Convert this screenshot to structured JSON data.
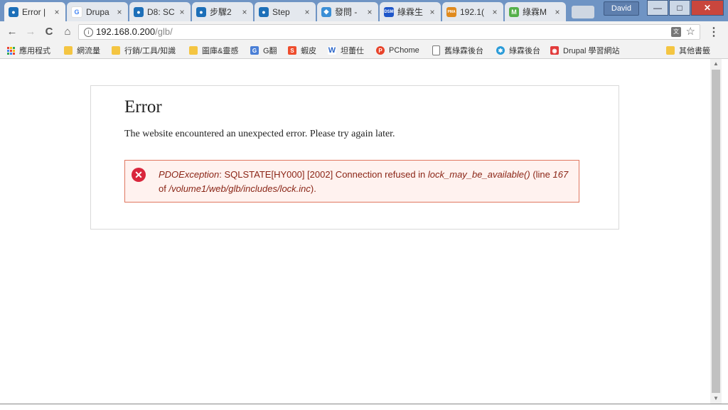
{
  "tabs": [
    {
      "title": "Error |",
      "color": "#1d6fb8",
      "icon": "drupal-icon",
      "active": true
    },
    {
      "title": "Drupa",
      "color": "#4285f4",
      "icon": "google-icon"
    },
    {
      "title": "D8: SC",
      "color": "#1d6fb8",
      "icon": "drupal-icon"
    },
    {
      "title": "步驟2",
      "color": "#1d6fb8",
      "icon": "drupal-icon"
    },
    {
      "title": "Step",
      "color": "#1d6fb8",
      "icon": "drupal-icon"
    },
    {
      "title": "發問 -",
      "color": "#3b8fd6",
      "icon": "forum-icon"
    },
    {
      "title": "綠霖生",
      "color": "#1f56c9",
      "icon": "dsm-icon",
      "icon_text": "DSM"
    },
    {
      "title": "192.1(",
      "color": "#e08a1e",
      "icon": "pma-icon",
      "icon_text": "PMA"
    },
    {
      "title": "綠霖M",
      "color": "#55b04a",
      "icon": "m-icon",
      "icon_text": "M"
    }
  ],
  "tab_close": "×",
  "window": {
    "user": "David",
    "minimize": "—",
    "maximize": "□",
    "close": "✕"
  },
  "toolbar": {
    "back": "←",
    "forward": "→",
    "reload": "C",
    "home": "⌂",
    "url_host": "192.168.0.200",
    "url_path": "/glb/",
    "info": "i",
    "translate": "文",
    "star": "☆",
    "menu": "⋮"
  },
  "bookmarks": [
    {
      "label": "應用程式",
      "icon": "apps-icon"
    },
    {
      "label": "網流量",
      "icon": "folder-icon"
    },
    {
      "label": "行銷/工具/知識",
      "icon": "folder-icon"
    },
    {
      "label": "圖庫&靈感",
      "icon": "folder-icon"
    },
    {
      "label": "G翻",
      "icon": "translate-icon",
      "color": "#4a7fd6"
    },
    {
      "label": "蝦皮",
      "icon": "shopee-icon",
      "color": "#ee4d2d",
      "icon_text": "S"
    },
    {
      "label": "坦蕾仕",
      "icon": "w-icon",
      "color": "#2b66c9",
      "icon_text": "W"
    },
    {
      "label": "PChome",
      "icon": "pchome-icon",
      "color": "#e8432a",
      "icon_text": "P"
    },
    {
      "label": "舊綠霖後台",
      "icon": "page-icon"
    },
    {
      "label": "綠霖後台",
      "icon": "gear-icon",
      "color": "#2a9bd8"
    },
    {
      "label": "Drupal 學習網站",
      "icon": "drupal-bookmark-icon",
      "color": "#e23b3b"
    }
  ],
  "other_bookmarks": "其他書籤",
  "page": {
    "title": "Error",
    "message": "The website encountered an unexpected error. Please try again later.",
    "error": {
      "exception": "PDOException",
      "text1": ": SQLSTATE[HY000] [2002] Connection refused in ",
      "function": "lock_may_be_available()",
      "text2": " (line ",
      "line": "167",
      "text3": " of ",
      "file": "/volume1/web/glb/includes/lock.inc",
      "text4": ")."
    }
  },
  "scrollbar": {
    "up": "▲",
    "down": "▼"
  }
}
